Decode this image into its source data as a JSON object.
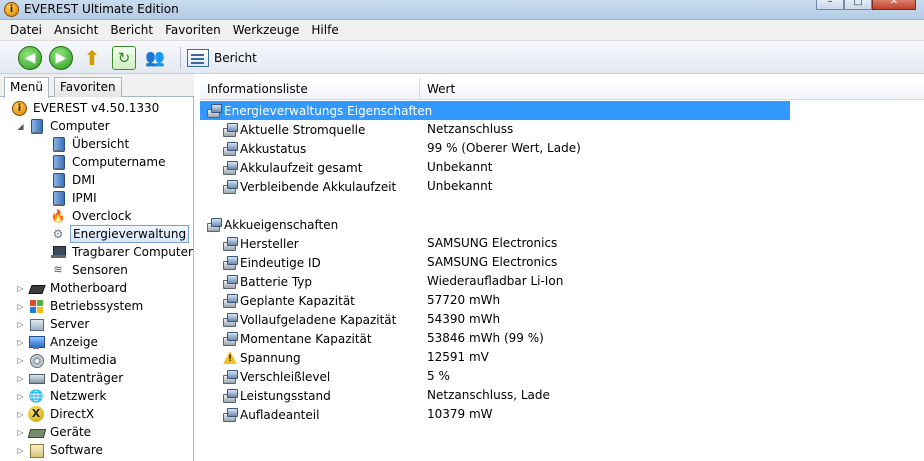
{
  "window": {
    "title": "EVEREST Ultimate Edition",
    "buttons": {
      "minimize": "–",
      "maximize": "□",
      "close": "✕"
    }
  },
  "menubar": [
    "Datei",
    "Ansicht",
    "Bericht",
    "Favoriten",
    "Werkzeuge",
    "Hilfe"
  ],
  "toolbar": {
    "back_icon": "back-arrow-icon",
    "forward_icon": "forward-arrow-icon",
    "up_icon": "folder-up-icon",
    "refresh_icon": "refresh-icon",
    "users_icon": "users-icon",
    "report_label": "Bericht"
  },
  "left_tabs": {
    "menu": "Menü",
    "favorites": "Favoriten"
  },
  "tree": {
    "root": "EVEREST v4.50.1330",
    "computer": "Computer",
    "computer_children": [
      "Übersicht",
      "Computername",
      "DMI",
      "IPMI",
      "Overclock",
      "Energieverwaltung",
      "Tragbarer Computer",
      "Sensoren"
    ],
    "selected": "Energieverwaltung",
    "top_level": [
      "Motherboard",
      "Betriebssystem",
      "Server",
      "Anzeige",
      "Multimedia",
      "Datenträger",
      "Netzwerk",
      "DirectX",
      "Geräte",
      "Software"
    ]
  },
  "columns": {
    "name": "Informationsliste",
    "value": "Wert"
  },
  "groups": [
    {
      "title": "Energieverwaltungs Eigenschaften",
      "items": [
        {
          "name": "Aktuelle Stromquelle",
          "value": "Netzanschluss",
          "icon": "battery"
        },
        {
          "name": "Akkustatus",
          "value": "99 % (Oberer Wert, Lade)",
          "icon": "battery"
        },
        {
          "name": "Akkulaufzeit gesamt",
          "value": "Unbekannt",
          "icon": "battery"
        },
        {
          "name": "Verbleibende Akkulaufzeit",
          "value": "Unbekannt",
          "icon": "battery"
        }
      ]
    },
    {
      "title": "Akkueigenschaften",
      "items": [
        {
          "name": "Hersteller",
          "value": "SAMSUNG Electronics",
          "icon": "battery"
        },
        {
          "name": "Eindeutige ID",
          "value": "SAMSUNG Electronics",
          "icon": "battery"
        },
        {
          "name": "Batterie Typ",
          "value": "Wiederaufladbar Li-Ion",
          "icon": "battery"
        },
        {
          "name": "Geplante Kapazität",
          "value": "57720 mWh",
          "icon": "battery"
        },
        {
          "name": "Vollaufgeladene Kapazität",
          "value": "54390 mWh",
          "icon": "battery"
        },
        {
          "name": "Momentane Kapazität",
          "value": "53846 mWh  (99 %)",
          "icon": "battery"
        },
        {
          "name": "Spannung",
          "value": "12591 mV",
          "icon": "warning"
        },
        {
          "name": "Verschleißlevel",
          "value": "5 %",
          "icon": "battery"
        },
        {
          "name": "Leistungsstand",
          "value": "Netzanschluss, Lade",
          "icon": "battery"
        },
        {
          "name": "Aufladeanteil",
          "value": "10379 mW",
          "icon": "battery"
        }
      ]
    }
  ],
  "colors": {
    "selection": "#3399ff",
    "tree_selected_border": "#7da2ce"
  }
}
